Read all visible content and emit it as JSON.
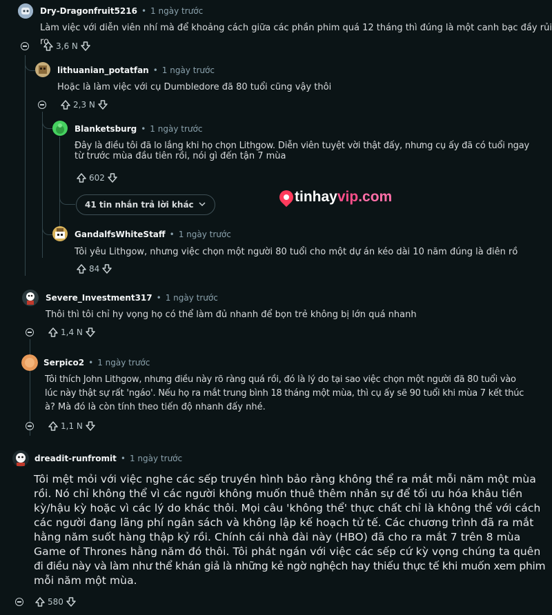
{
  "comments": [
    {
      "username": "Dry-Dragonfruit5216",
      "time": "1 ngày trước",
      "text": "Làm việc với diễn viên nhí mà để khoảng cách giữa các phần phim quá 12 tháng thì đúng là một canh bạc đầy rủi ro",
      "votes": "3,6 N"
    },
    {
      "username": "lithuanian_potatfan",
      "time": "1 ngày trước",
      "text": "Hoặc là làm việc với cụ Dumbledore đã 80 tuổi cũng vậy thôi",
      "votes": "2,3 N"
    },
    {
      "username": "Blanketsburg",
      "time": "1 ngày trước",
      "line1": "Đây là điều tôi đã lo lắng khi họ chọn Lithgow. Diễn viên tuyệt vời thật đấy, nhưng cụ ấy đã có tuổi ngay",
      "line2": "từ trước mùa đầu tiên rồi, nói gì đến tận 7 mùa",
      "votes": "602"
    },
    {
      "username": "GandalfsWhiteStaff",
      "time": "1 ngày trước",
      "text": "Tôi yêu Lithgow, nhưng việc chọn một người 80 tuổi cho một dự án kéo dài 10 năm đúng là điên rồ",
      "votes": "84"
    },
    {
      "username": "Severe_Investment317",
      "time": "1 ngày trước",
      "text": "Thôi thì tôi chỉ hy vọng họ có thể làm đủ nhanh để bọn trẻ không bị lớn quá nhanh",
      "votes": "1,4 N"
    },
    {
      "username": "Serpico2",
      "time": "1 ngày trước",
      "line1": "Tôi thích John Lithgow, nhưng điều này rõ ràng quá rồi, đó là lý do tại sao việc chọn một người đã 80 tuổi vào",
      "line2": "lúc này thật sự rất 'ngáo'. Nếu họ ra mắt trung bình 18 tháng một mùa, thì cụ ấy sẽ 90 tuổi khi mùa 7 kết thúc",
      "line3": "à? Mà đó là còn tính theo tiến độ nhanh đấy nhé.",
      "votes": "1,1 N"
    },
    {
      "username": "dreadit-runfromit",
      "time": "1 ngày trước",
      "lines": [
        "Tôi mệt mỏi với việc nghe các sếp truyền hình bảo rằng không thể ra mắt mỗi năm một mùa",
        "rồi. Nó chỉ không thể vì các người không muốn thuê thêm nhân sự để tối ưu hóa khâu tiền",
        "kỳ/hậu kỳ hoặc vì các lý do khác thôi. Mọi câu 'không thể' thực chất chỉ là không thể với cách",
        "các người đang lãng phí ngân sách và không lập kế hoạch tử tế. Các chương trình đã ra mắt",
        "hằng năm suốt hàng thập kỷ rồi. Chính cái nhà đài này (HBO) đã cho ra mắt 7 trên 8 mùa",
        "Game of Thrones hằng năm đó thôi. Tôi phát ngán với việc các sếp cứ kỳ vọng chúng ta quên",
        "đi điều này và làm như thể khán giả là những kẻ ngờ nghệch hay thiếu thực tế khi muốn xem phim",
        "mỗi năm một mùa."
      ],
      "votes": "580"
    }
  ],
  "more_replies_label": "41 tin nhắn trả lời khác",
  "separator": "•",
  "watermark": {
    "prefix": "tinhay",
    "vip": "vip",
    "suffix": ".com"
  },
  "colors": {
    "background": "#0b1416",
    "brand": "#ff3b5c"
  }
}
